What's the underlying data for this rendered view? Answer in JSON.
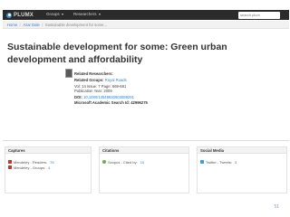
{
  "topbar": {
    "logo": "PLUMX",
    "nav": [
      {
        "label": "Groups"
      },
      {
        "label": "Researchers"
      }
    ],
    "search_placeholder": "search plum"
  },
  "breadcrumb": {
    "items": [
      "Home",
      "Azar Dale"
    ],
    "current": "Sustainable development for some..."
  },
  "article": {
    "title": "Sustainable development for some: Green urban development and affordability",
    "related_researchers_label": "Related Researchers:",
    "related_groups_label": "Related Groups:",
    "related_groups_value": "Royal Roads",
    "vol_line": "Vol: 14  Issue: 7  Page: 669-681",
    "pub_year": "Publication Year: 2009",
    "doi_label": "DOI:",
    "doi_value": "10.1080/13549830903089291",
    "msas_label": "Microsoft Academic Search Id:",
    "msas_value": "42996275"
  },
  "panels": {
    "captures": {
      "title": "Captures",
      "rows": [
        {
          "label": "Mendeley - Readers:",
          "count": "76"
        },
        {
          "label": "Mendeley - Groups:",
          "count": "4"
        }
      ]
    },
    "citations": {
      "title": "Citations",
      "rows": [
        {
          "label": "Scopus - Cited by:",
          "count": "10"
        }
      ]
    },
    "social": {
      "title": "Social Media",
      "rows": [
        {
          "label": "Twitter - Tweets:",
          "count": "3"
        }
      ]
    }
  },
  "page_number": "51"
}
